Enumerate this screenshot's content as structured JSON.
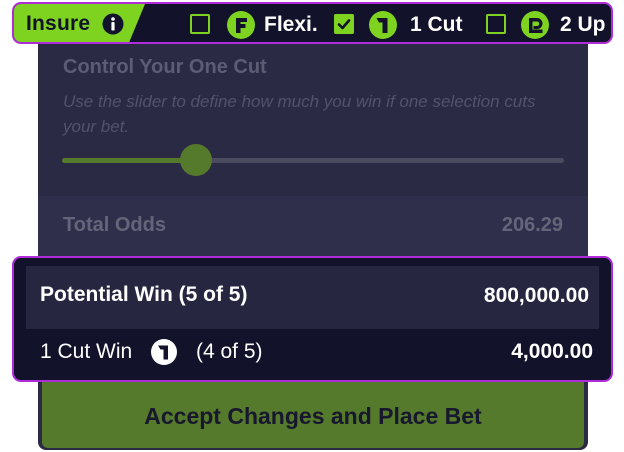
{
  "insure": {
    "label": "Insure",
    "options": [
      {
        "label": "Flexi.",
        "checked": false,
        "icon": "flexi-f-icon"
      },
      {
        "label": "1 Cut",
        "checked": true,
        "icon": "one-cut-icon"
      },
      {
        "label": "2 Up",
        "checked": false,
        "icon": "two-up-icon"
      }
    ]
  },
  "one_cut": {
    "title": "Control Your One Cut",
    "description": "Use the slider to define how much you win if one selection cuts your bet.",
    "slider_value_fraction": 0.25
  },
  "total_odds": {
    "label": "Total Odds",
    "value": "206.29"
  },
  "potential_win": {
    "label": "Potential Win (5 of 5)",
    "value": "800,000.00"
  },
  "cut_win": {
    "label": "1 Cut Win",
    "count": "(4 of 5)",
    "value": "4,000.00"
  },
  "place_bet": {
    "label": "Accept Changes and Place Bet"
  },
  "colors": {
    "accent_green": "#7ed321",
    "highlight_border": "#b02cd9",
    "panel_dark": "#12122a",
    "disabled_green": "#557a2c"
  }
}
